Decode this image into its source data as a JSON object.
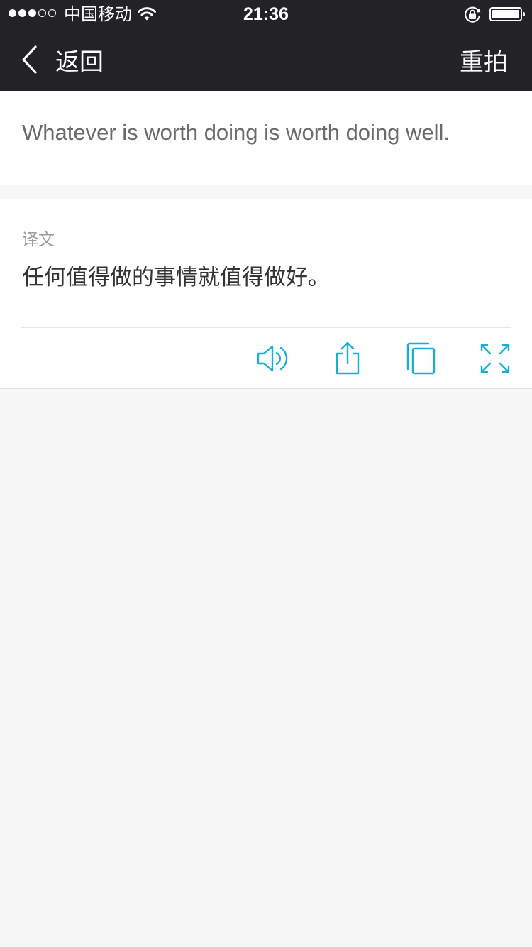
{
  "status_bar": {
    "carrier": "中国移动",
    "time": "21:36",
    "signal_bars_filled": 3,
    "signal_bars_total": 5
  },
  "nav": {
    "back_label": "返回",
    "retake_label": "重拍"
  },
  "source": {
    "text": "Whatever is worth doing is worth doing well."
  },
  "translation": {
    "label": "译文",
    "text": "任何值得做的事情就值得做好。"
  },
  "colors": {
    "header_bg": "#232227",
    "accent": "#1aaed7",
    "background": "#f7f7f7"
  },
  "icons": [
    "speaker-icon",
    "share-icon",
    "copy-icon",
    "fullscreen-icon"
  ]
}
